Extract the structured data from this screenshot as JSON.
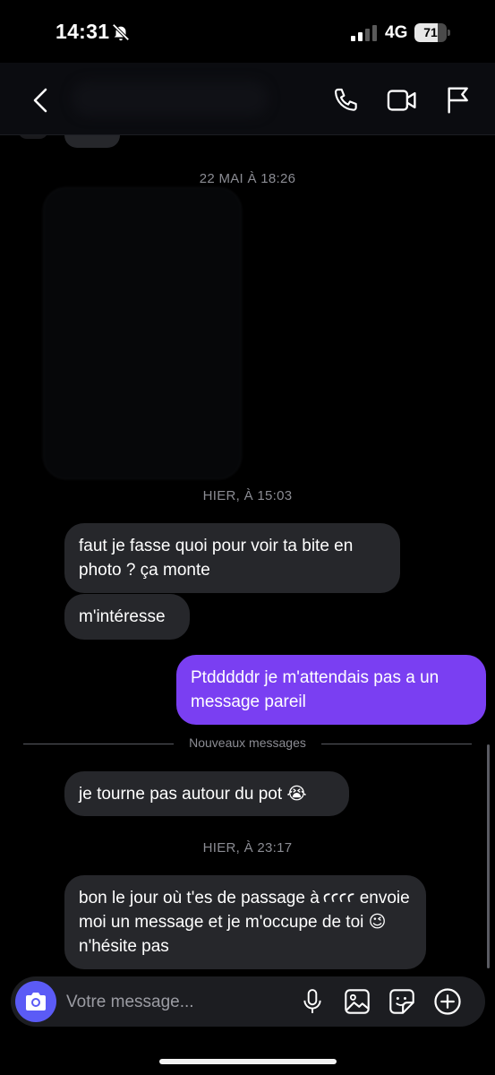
{
  "status_bar": {
    "time": "14:31",
    "network": "4G",
    "battery": "71",
    "battery_level": 0.71,
    "silent_icon": "bell-slash-icon",
    "signal_icon": "cellular-signal-icon"
  },
  "nav": {
    "back_icon": "chevron-left-icon",
    "call_icon": "phone-icon",
    "video_icon": "video-camera-icon",
    "report_icon": "flag-icon"
  },
  "chat": {
    "date_1": "22 MAI À 18:26",
    "date_2": "HIER, À 15:03",
    "date_3": "HIER, À 23:17",
    "messages": [
      {
        "from": "them",
        "text": "faut je fasse quoi pour voir ta bite en photo ? ça monte"
      },
      {
        "from": "them",
        "text": "m'intéresse"
      },
      {
        "from": "me",
        "text": "Ptdddddr je m'attendais pas a un message pareil"
      },
      {
        "from": "them",
        "text": "je tourne pas autour du pot 😭"
      },
      {
        "from": "them",
        "text": "bon le jour où t'es de passage à ꜥꜥꜥꜥ envoie moi un message et je m'occupe de toi 😉 n'hésite pas"
      }
    ],
    "new_messages_label": "Nouveaux messages"
  },
  "composer": {
    "placeholder": "Votre message...",
    "camera_icon": "camera-icon",
    "mic_icon": "microphone-icon",
    "gallery_icon": "image-icon",
    "sticker_icon": "sticker-icon",
    "add_icon": "plus-circle-icon"
  },
  "colors": {
    "background": "#000000",
    "received_bubble": "#26272b",
    "sent_bubble": "#7a3ff2",
    "accent": "#5b5bf6"
  }
}
